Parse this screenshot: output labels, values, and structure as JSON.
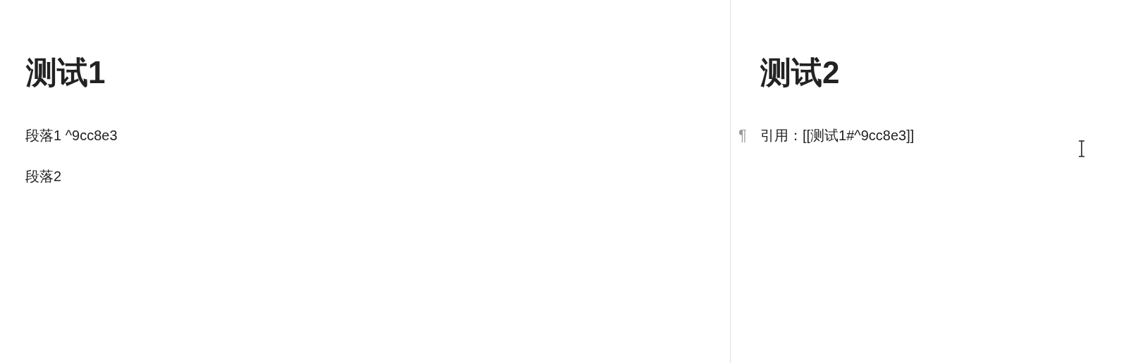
{
  "panes": [
    {
      "heading": "测试1",
      "paragraphs": [
        {
          "text": "段落1 ^9cc8e3"
        },
        {
          "text": "段落2"
        }
      ]
    },
    {
      "heading": "测试2",
      "paragraphs": [
        {
          "text": "引用：[[测试1#^9cc8e3]]",
          "marker": "¶"
        }
      ]
    }
  ]
}
